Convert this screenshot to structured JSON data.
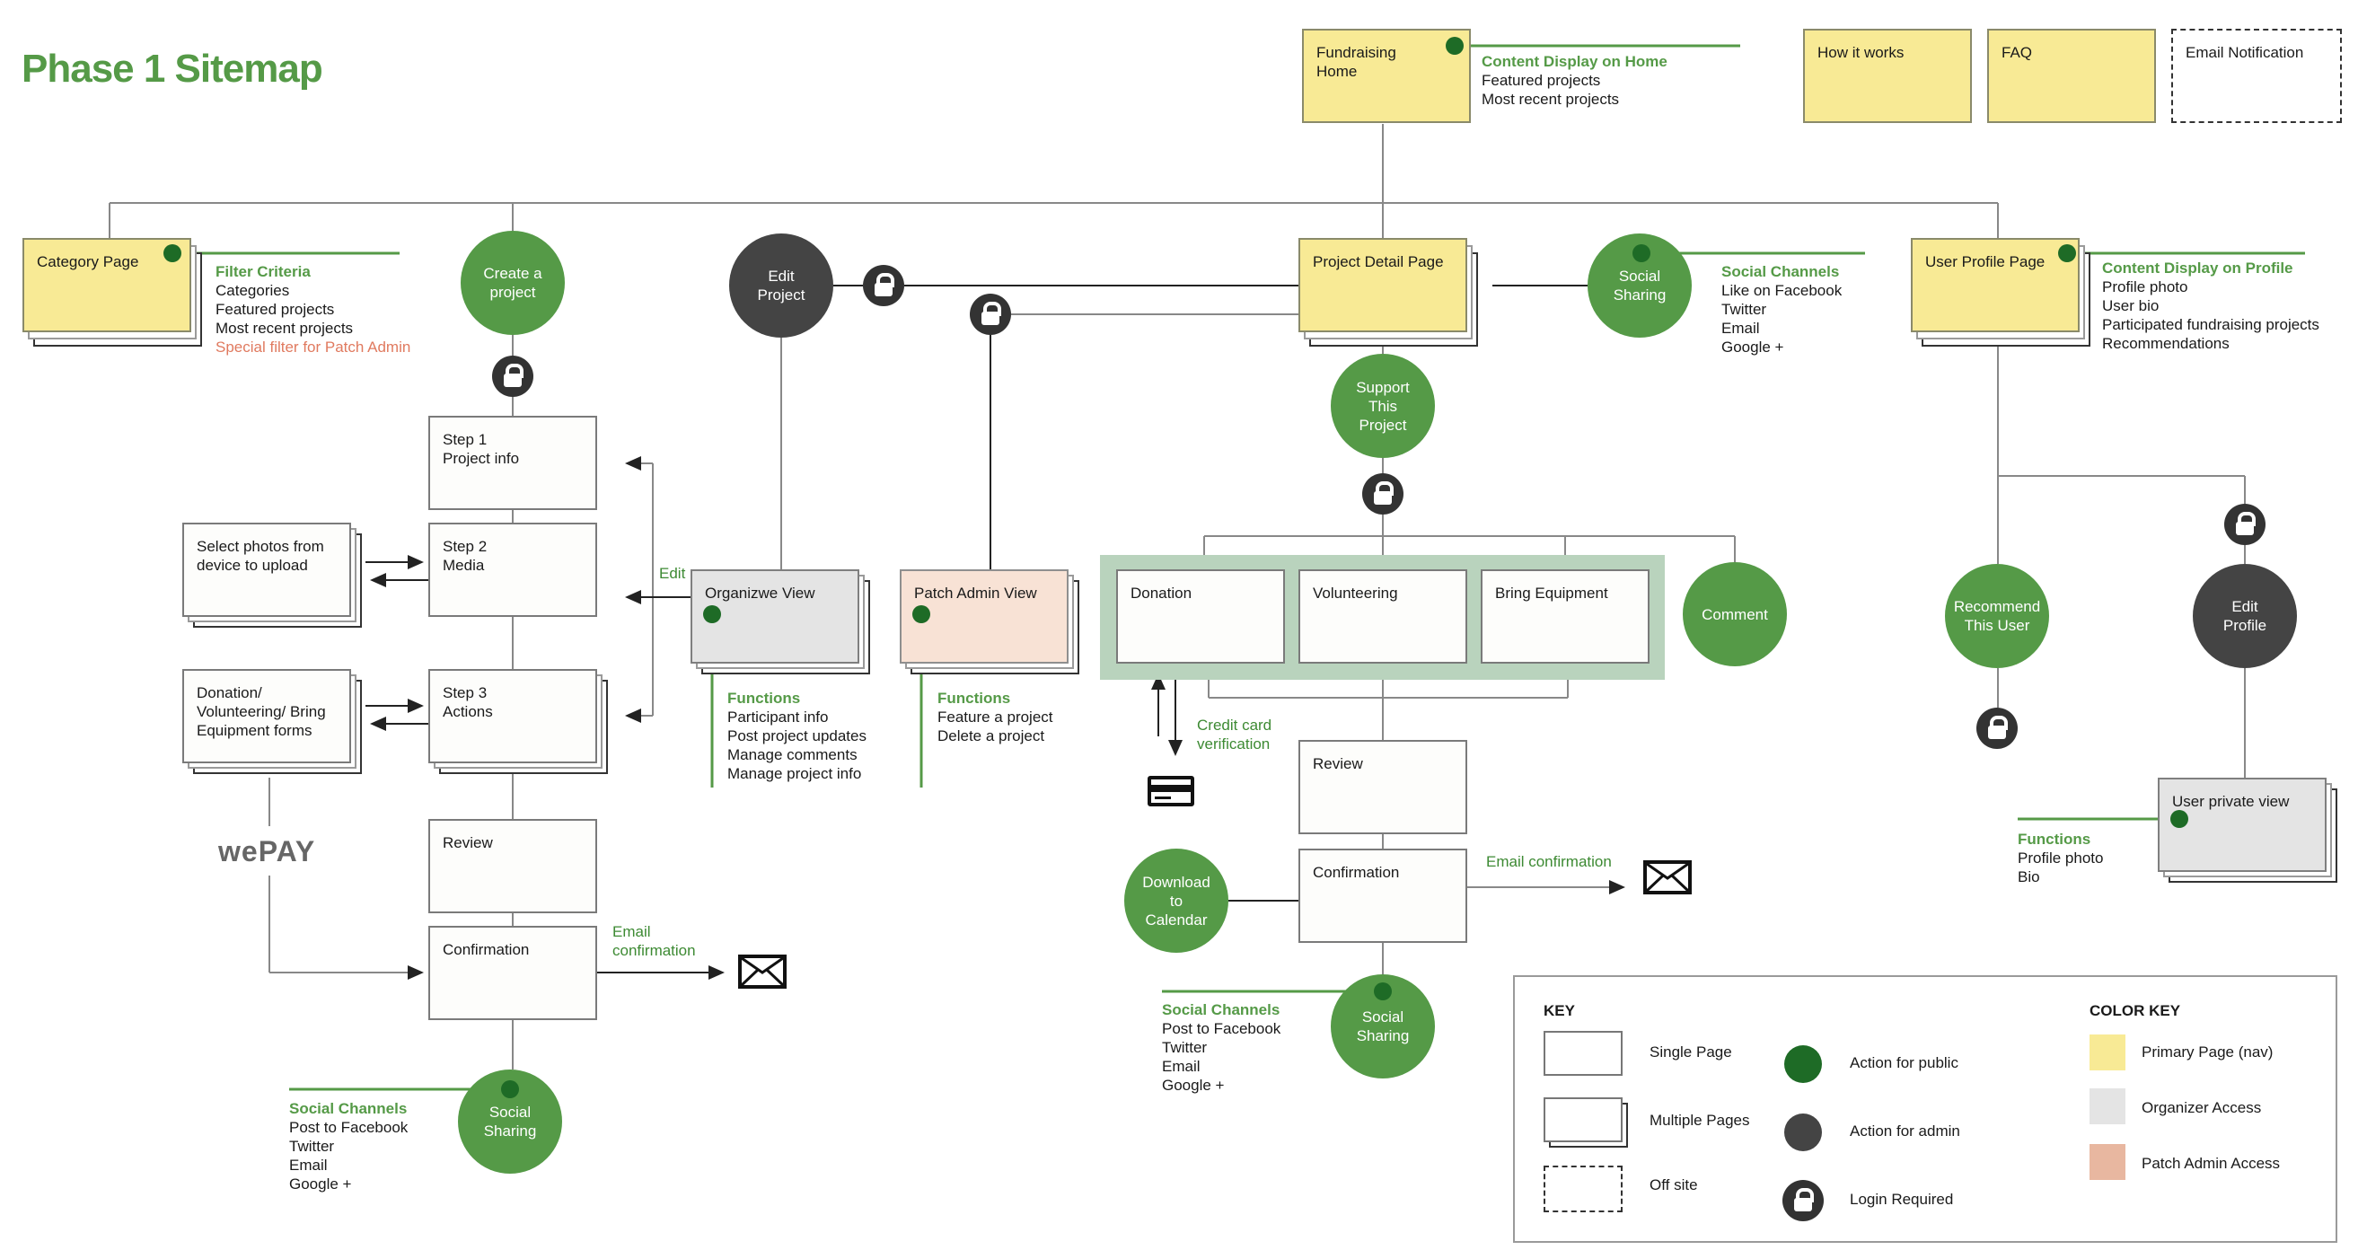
{
  "title": "Phase 1 Sitemap",
  "colors": {
    "primary_yellow": "#f8ea95",
    "organizer_gray": "#e4e4e4",
    "patch_admin_peach": "#f8e2d5",
    "public_action_green": "#559a47",
    "admin_action_dark": "#444444",
    "accent_green_text": "#559a47",
    "special_filter_red": "#e07a5f"
  },
  "top_nav": {
    "fundraising_home": "Fundraising Home",
    "how_it_works": "How it works",
    "faq": "FAQ",
    "email_notification": "Email Notification"
  },
  "home_note": {
    "heading": "Content Display on Home",
    "items": [
      "Featured projects",
      "Most recent projects"
    ]
  },
  "category": {
    "label": "Category Page",
    "note_heading": "Filter Criteria",
    "note_items": [
      "Categories",
      "Featured projects",
      "Most recent projects"
    ],
    "note_special": "Special filter for Patch Admin"
  },
  "create_flow": {
    "create_circle": "Create a project",
    "step1": "Step 1\nProject info",
    "step1_title": "Step 1",
    "step1_sub": "Project info",
    "step2_title": "Step 2",
    "step2_sub": "Media",
    "step3_title": "Step 3",
    "step3_sub": "Actions",
    "review": "Review",
    "confirmation": "Confirmation",
    "select_photos": "Select photos from device to upload",
    "action_forms": "Donation/ Volunteering/ Bring Equipment forms",
    "payment_provider": "wePAY",
    "edit_label": "Edit",
    "email_label": "Email confirmation",
    "social_circle": "Social Sharing",
    "social_heading": "Social Channels",
    "social_items": [
      "Post to Facebook",
      "Twitter",
      "Email",
      "Google +"
    ]
  },
  "edit_project": {
    "circle": "Edit Project",
    "organizer_view": "Organizwe View",
    "organizer_functions_heading": "Functions",
    "organizer_functions": [
      "Participant info",
      "Post project updates",
      "Manage comments",
      "Manage project info"
    ],
    "patch_admin_view": "Patch Admin View",
    "patch_functions_heading": "Functions",
    "patch_functions": [
      "Feature a project",
      "Delete a project"
    ]
  },
  "project_detail": {
    "label": "Project Detail Page",
    "social_circle": "Social Sharing",
    "social_heading": "Social Channels",
    "social_items": [
      "Like on Facebook",
      "Twitter",
      "Email",
      "Google +"
    ],
    "support_circle": "Support This Project",
    "donation": "Donation",
    "volunteering": "Volunteering",
    "bring_equipment": "Bring Equipment",
    "comment": "Comment",
    "credit_card_label": "Credit card verification",
    "review": "Review",
    "confirmation": "Confirmation",
    "email_label": "Email confirmation",
    "download_calendar": "Download to Calendar",
    "bottom_social_circle": "Social Sharing",
    "bottom_social_heading": "Social Channels",
    "bottom_social_items": [
      "Post to Facebook",
      "Twitter",
      "Email",
      "Google +"
    ]
  },
  "user_profile": {
    "label": "User Profile Page",
    "note_heading": "Content Display on Profile",
    "note_items": [
      "Profile photo",
      "User bio",
      "Participated fundraising projects",
      "Recommendations"
    ],
    "recommend_circle": "Recommend This User",
    "edit_profile_circle": "Edit Profile",
    "private_view": "User private view",
    "functions_heading": "Functions",
    "functions": [
      "Profile photo",
      "Bio"
    ]
  },
  "key": {
    "heading": "KEY",
    "single_page": "Single Page",
    "multiple_pages": "Multiple Pages",
    "off_site": "Off site",
    "action_public": "Action for public",
    "action_admin": "Action for admin",
    "login_required": "Login Required",
    "color_heading": "COLOR KEY",
    "primary_page": "Primary Page (nav)",
    "organizer_access": "Organizer Access",
    "patch_admin_access": "Patch Admin Access",
    "public_dot_color": "#1e6b26",
    "admin_dot_color": "#444444",
    "primary_swatch": "#f8ea95",
    "organizer_swatch": "#e4e4e4",
    "patch_swatch": "#e8b7a0"
  }
}
